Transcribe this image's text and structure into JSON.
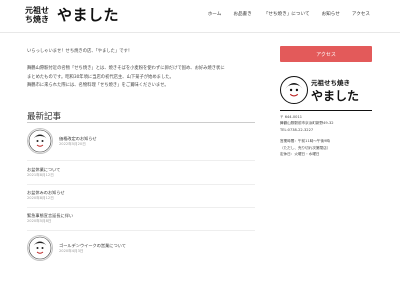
{
  "header": {
    "logo_small": "元祖せち焼き",
    "logo_big": "やました",
    "nav": [
      "ホーム",
      "お品書き",
      "「せち焼き」について",
      "お知らせ",
      "アクセス"
    ]
  },
  "intro": {
    "line1": "いらっしゃいませ！せち焼きの店、「やました」です！",
    "line2": "舞鶴山際駅付近の名物「せち焼き」とは、焼きそばを小麦粉を使わずに卵だけで固め、お好み焼き状に",
    "line3": "まとめたものです。昭和30年頃に当店の初代店主、山下菊子が始めました。",
    "line4": "舞鶴市に来られた際には、名物料理「せち焼き」をご賞味くださいませ。"
  },
  "recent": {
    "title": "最新記事",
    "posts": [
      {
        "title": "価格改定のお知らせ",
        "date": "2022年5月20日"
      },
      {
        "title": "お盆休業について",
        "date": "2021年8月12日"
      },
      {
        "title": "お盆休みのお知らせ",
        "date": "2020年8月12日"
      },
      {
        "title": "緊急事態宣言延長に伴い",
        "date": "2020年5月8日"
      },
      {
        "title": "ゴールデンウイークの営業について",
        "date": "2020年4月3日"
      }
    ]
  },
  "sidebar": {
    "access_label": "アクセス",
    "logo_small": "元祖せち焼き",
    "logo_big": "やました",
    "postal": "〒 644-0011",
    "address": "舞鶴山際駅前市京浜町新野49-32",
    "tel": "TEL:0738-22-3227",
    "hours_label": "営業時間：午前11時〜午後9時",
    "hours_note": "（ただし、売り切れ次第閉店）",
    "holiday": "定休日：火曜日・水曜日"
  }
}
